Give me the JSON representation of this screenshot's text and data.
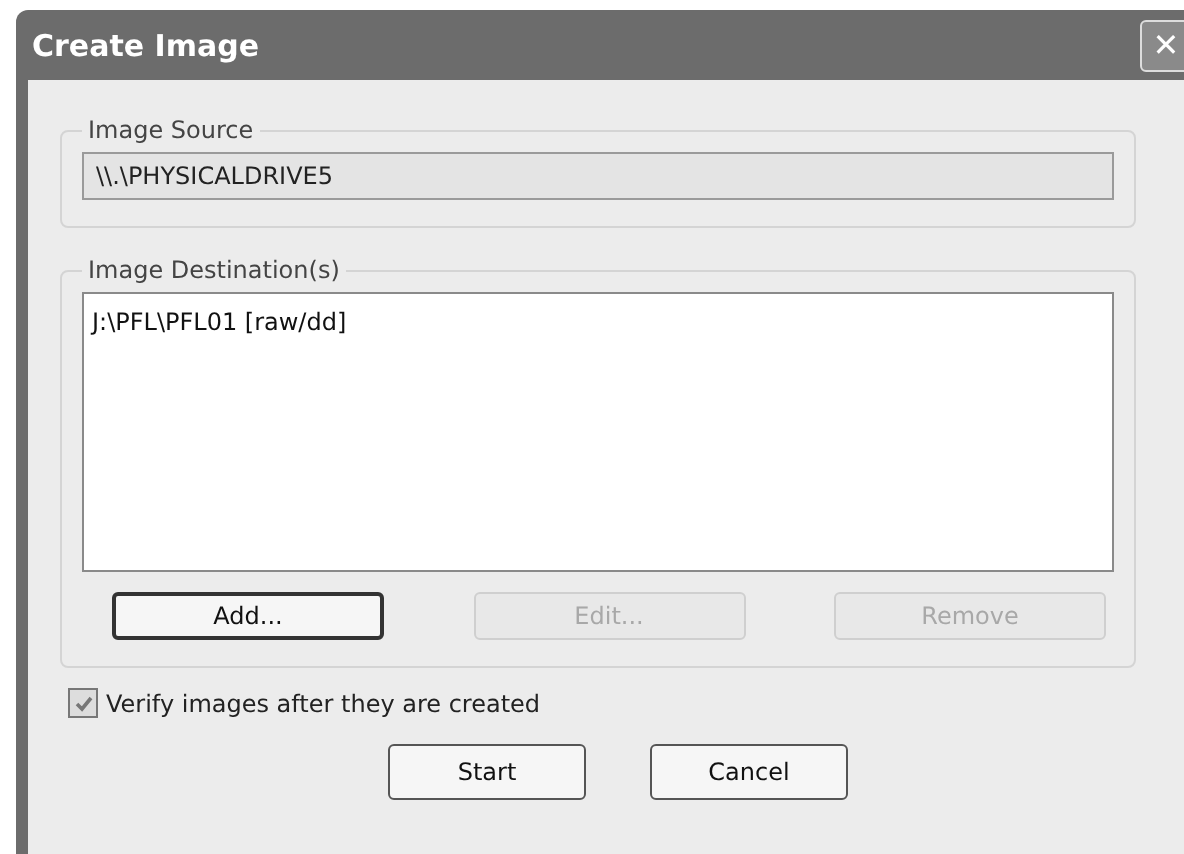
{
  "window": {
    "title": "Create Image",
    "close_glyph": "✕"
  },
  "image_source": {
    "label": "Image Source",
    "value": "\\\\.\\PHYSICALDRIVE5"
  },
  "image_destinations": {
    "label": "Image Destination(s)",
    "items": [
      "J:\\PFL\\PFL01 [raw/dd]"
    ],
    "buttons": [
      {
        "label": "Add...",
        "disabled": false,
        "default": true
      },
      {
        "label": "Edit...",
        "disabled": true,
        "default": false
      },
      {
        "label": "Remove",
        "disabled": true,
        "default": false
      }
    ]
  },
  "verify": {
    "label": "Verify images after they are created",
    "checked": true
  },
  "buttons": [
    "Start",
    "Cancel"
  ]
}
